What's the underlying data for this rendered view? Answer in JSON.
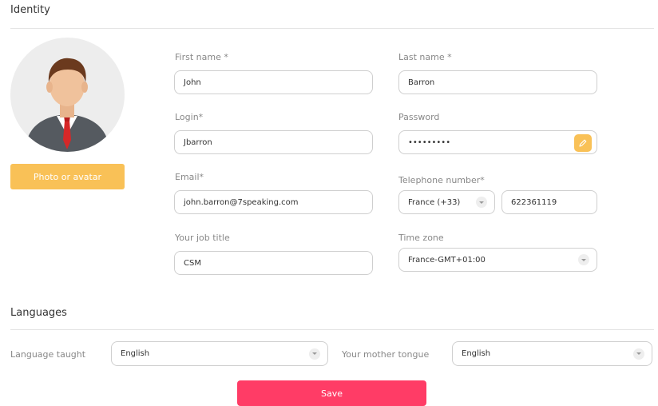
{
  "identity": {
    "title": "Identity",
    "photo_button": "Photo or avatar",
    "first_name": {
      "label": "First name *",
      "value": "John"
    },
    "last_name": {
      "label": "Last name *",
      "value": "Barron"
    },
    "login": {
      "label": "Login*",
      "value": "Jbarron"
    },
    "password": {
      "label": "Password",
      "value": "•••••••••"
    },
    "email": {
      "label": "Email*",
      "value": "john.barron@7speaking.com"
    },
    "telephone": {
      "label": "Telephone number*",
      "country": "France (+33)",
      "number": "622361119"
    },
    "job_title": {
      "label": "Your job title",
      "value": "CSM"
    },
    "time_zone": {
      "label": "Time zone",
      "value": "France-GMT+01:00"
    }
  },
  "languages": {
    "title": "Languages",
    "taught": {
      "label": "Language taught",
      "value": "English"
    },
    "mother_tongue": {
      "label": "Your mother tongue",
      "value": "English"
    }
  },
  "save_label": "Save",
  "colors": {
    "accent_yellow": "#f9c157",
    "save_pink": "#ff3c66"
  }
}
